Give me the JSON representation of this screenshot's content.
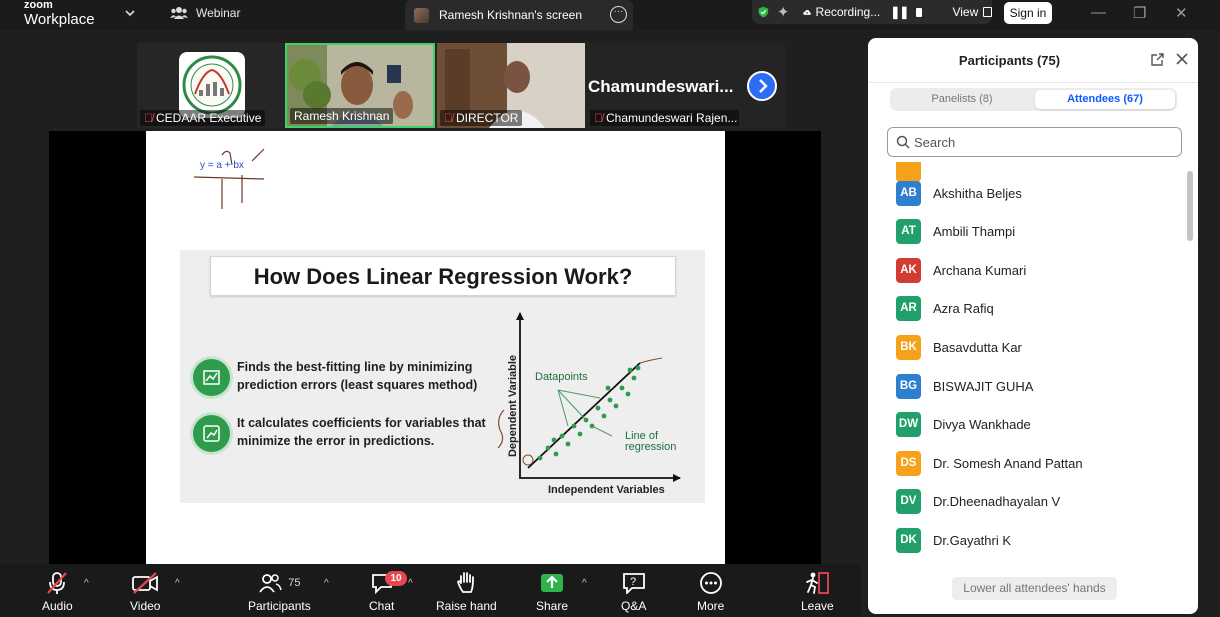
{
  "app": {
    "brand_top": "zoom",
    "brand_bottom": "Workplace"
  },
  "header": {
    "webinar_label": "Webinar",
    "screen_tab_title": "Ramesh Krishnan's screen",
    "recording_label": "Recording...",
    "view_label": "View",
    "signin_label": "Sign in"
  },
  "video_tiles": [
    {
      "name": "CEDAAR Executive"
    },
    {
      "name": "Ramesh Krishnan"
    },
    {
      "name": "DIRECTOR"
    },
    {
      "name": "Chamundeswari Rajen...",
      "big_name": "Chamundeswari..."
    }
  ],
  "slide": {
    "formula": "y = a + bx",
    "title": "How Does Linear Regression Work?",
    "bullets": [
      {
        "line1": "Finds the best-fitting line by minimizing",
        "line2": "prediction errors (least squares method)"
      },
      {
        "line1": "It calculates coefficients for variables that",
        "line2": "minimize the error in predictions."
      }
    ],
    "chart_labels": {
      "datapoints": "Datapoints",
      "line_of": "Line of",
      "regression": "regression",
      "x_axis": "Independent Variables",
      "y_axis": "Dependent Variable"
    }
  },
  "toolbar": {
    "audio": "Audio",
    "video": "Video",
    "participants": "Participants",
    "participant_count": "75",
    "chat": "Chat",
    "chat_badge": "10",
    "raise_hand": "Raise hand",
    "share": "Share",
    "qa": "Q&A",
    "more": "More",
    "leave": "Leave"
  },
  "panel": {
    "title": "Participants (75)",
    "tabs": {
      "panelists": "Panelists (8)",
      "attendees": "Attendees (67)"
    },
    "search_placeholder": "Search",
    "lower_hands": "Lower all attendees' hands",
    "attendees": [
      {
        "initials": "AB",
        "name": "Akshitha Beljes",
        "color": "#2f7fd0"
      },
      {
        "initials": "AT",
        "name": "Ambili Thampi",
        "color": "#22a06b"
      },
      {
        "initials": "AK",
        "name": "Archana Kumari",
        "color": "#d13b32"
      },
      {
        "initials": "AR",
        "name": "Azra Rafiq",
        "color": "#22a06b"
      },
      {
        "initials": "BK",
        "name": "Basavdutta Kar",
        "color": "#f5a21a"
      },
      {
        "initials": "BG",
        "name": "BISWAJIT GUHA",
        "color": "#2f7fd0"
      },
      {
        "initials": "DW",
        "name": "Divya Wankhade",
        "color": "#22a06b"
      },
      {
        "initials": "DS",
        "name": "Dr. Somesh Anand Pattan",
        "color": "#f5a21a"
      },
      {
        "initials": "DV",
        "name": "Dr.Dheenadhayalan V",
        "color": "#22a06b"
      },
      {
        "initials": "DK",
        "name": "Dr.Gayathri K",
        "color": "#22a06b"
      }
    ]
  }
}
